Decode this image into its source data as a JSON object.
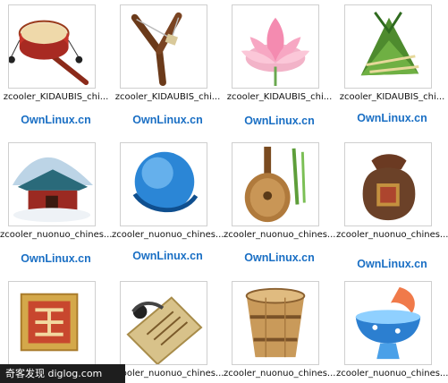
{
  "watermark": "OwnLinux.cn",
  "bottom_bar": "奇客发现  diglog.com",
  "rows": [
    {
      "items": [
        {
          "name": "zcooler_KIDAUBIS_chi...",
          "icon": "drum-icon"
        },
        {
          "name": "zcooler_KIDAUBIS_chi...",
          "icon": "slingshot-icon"
        },
        {
          "name": "zcooler_KIDAUBIS_chi...",
          "icon": "lotus-icon"
        },
        {
          "name": "zcooler_KIDAUBIS_chi...",
          "icon": "zongzi-icon"
        }
      ]
    },
    {
      "items": [
        {
          "name": "zcooler_nuonuo_chines...",
          "icon": "temple-icon"
        },
        {
          "name": "zcooler_nuonuo_chines...",
          "icon": "globe-icon"
        },
        {
          "name": "zcooler_nuonuo_chines...",
          "icon": "pipa-icon"
        },
        {
          "name": "zcooler_nuonuo_chines...",
          "icon": "money-bag-icon"
        }
      ]
    },
    {
      "items": [
        {
          "name": "",
          "icon": "seal-icon"
        },
        {
          "name": "zcooler_nuonuo_chines...",
          "icon": "letter-icon"
        },
        {
          "name": "zcooler_nuonuo_chines...",
          "icon": "bucket-icon"
        },
        {
          "name": "zcooler_nuonuo_chines...",
          "icon": "fish-bowl-icon"
        }
      ]
    }
  ]
}
